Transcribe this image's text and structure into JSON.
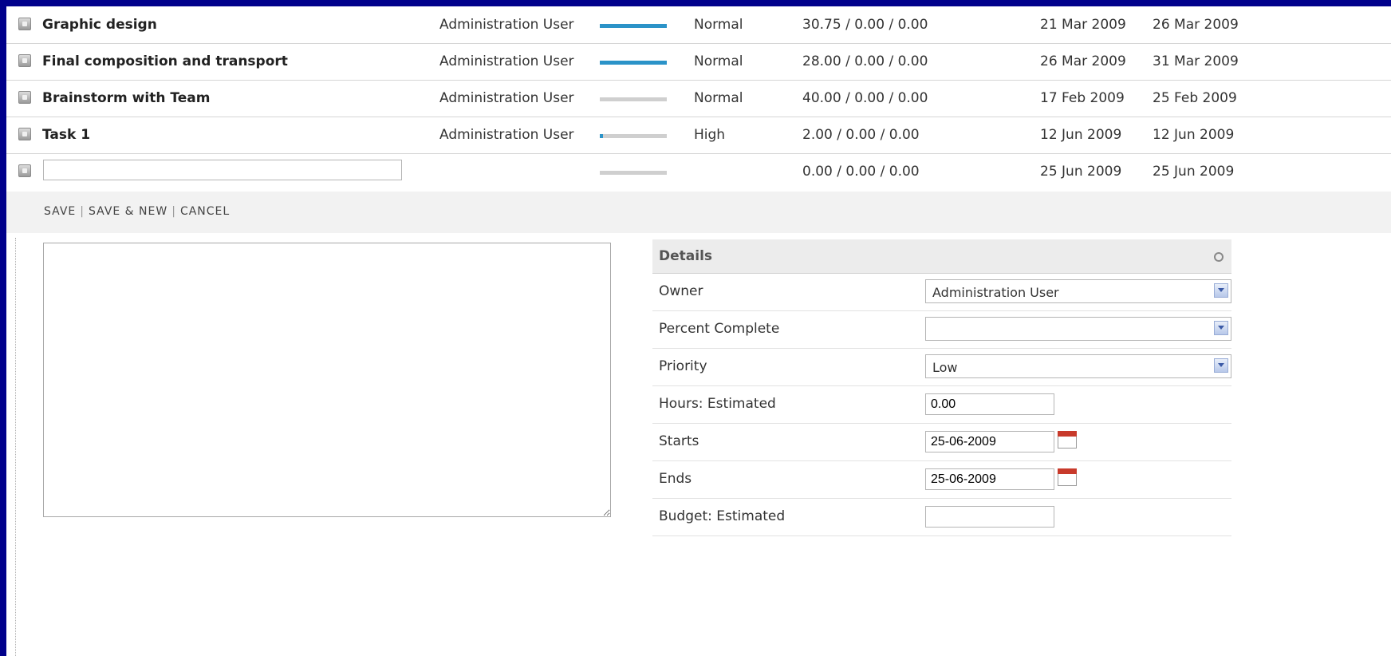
{
  "tasks": [
    {
      "name": "Graphic design",
      "owner": "Administration User",
      "progress": 1.0,
      "priority": "Normal",
      "hours": "30.75 / 0.00 / 0.00",
      "start": "21 Mar 2009",
      "end": "26 Mar 2009"
    },
    {
      "name": "Final composition and transport",
      "owner": "Administration User",
      "progress": 1.0,
      "priority": "Normal",
      "hours": "28.00 / 0.00 / 0.00",
      "start": "26 Mar 2009",
      "end": "31 Mar 2009"
    },
    {
      "name": "Brainstorm with Team",
      "owner": "Administration User",
      "progress": 0.0,
      "priority": "Normal",
      "hours": "40.00 / 0.00 / 0.00",
      "start": "17 Feb 2009",
      "end": "25 Feb 2009"
    },
    {
      "name": "Task 1",
      "owner": "Administration User",
      "progress": 0.05,
      "priority": "High",
      "hours": "2.00 / 0.00 / 0.00",
      "start": "12 Jun 2009",
      "end": "12 Jun 2009"
    }
  ],
  "new_task": {
    "name_value": "",
    "progress": 0.0,
    "hours": "0.00 / 0.00 / 0.00",
    "start": "25 Jun 2009",
    "end": "25 Jun 2009"
  },
  "actions": {
    "save": "SAVE",
    "save_new": "SAVE & NEW",
    "cancel": "CANCEL",
    "separator": "|"
  },
  "details": {
    "title": "Details",
    "owner": {
      "label": "Owner",
      "value": "Administration User"
    },
    "percent_complete": {
      "label": "Percent Complete",
      "value": ""
    },
    "priority": {
      "label": "Priority",
      "value": "Low"
    },
    "hours_estimated": {
      "label": "Hours: Estimated",
      "value": "0.00"
    },
    "starts": {
      "label": "Starts",
      "value": "25-06-2009"
    },
    "ends": {
      "label": "Ends",
      "value": "25-06-2009"
    },
    "budget_estimated": {
      "label": "Budget: Estimated",
      "value": ""
    }
  },
  "colors": {
    "progress_fill": "#2b93c8",
    "progress_track": "#cfcfcf",
    "frame": "#00008b"
  }
}
